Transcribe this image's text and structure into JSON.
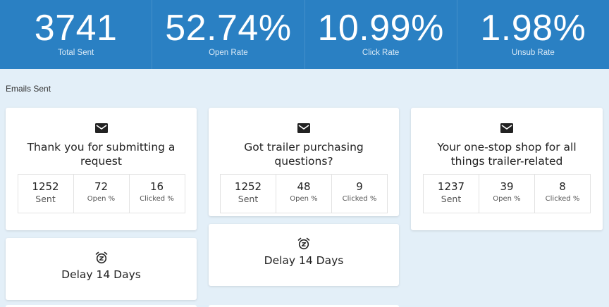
{
  "stats": [
    {
      "value": "3741",
      "label": "Total Sent"
    },
    {
      "value": "52.74%",
      "label": "Open Rate"
    },
    {
      "value": "10.99%",
      "label": "Click Rate"
    },
    {
      "value": "1.98%",
      "label": "Unsub Rate"
    }
  ],
  "section_title": "Emails Sent",
  "emails": [
    {
      "title": "Thank you for submitting a request",
      "sent": "1252",
      "sent_label": "Sent",
      "open": "72",
      "open_label": "Open %",
      "clicked": "16",
      "clicked_label": "Clicked %"
    },
    {
      "title": "Got trailer purchasing questions?",
      "sent": "1252",
      "sent_label": "Sent",
      "open": "48",
      "open_label": "Open %",
      "clicked": "9",
      "clicked_label": "Clicked %"
    },
    {
      "title": "Your one-stop shop for all things trailer-related",
      "sent": "1237",
      "sent_label": "Sent",
      "open": "39",
      "open_label": "Open %",
      "clicked": "8",
      "clicked_label": "Clicked %"
    }
  ],
  "delays": [
    {
      "label": "Delay 14 Days"
    },
    {
      "label": "Delay 14 Days"
    }
  ],
  "icons": {
    "email": "envelope-icon",
    "delay": "alarm-clock-snooze-icon"
  },
  "colors": {
    "header": "#2a80c3",
    "background": "#e3eff8",
    "card": "#ffffff"
  }
}
